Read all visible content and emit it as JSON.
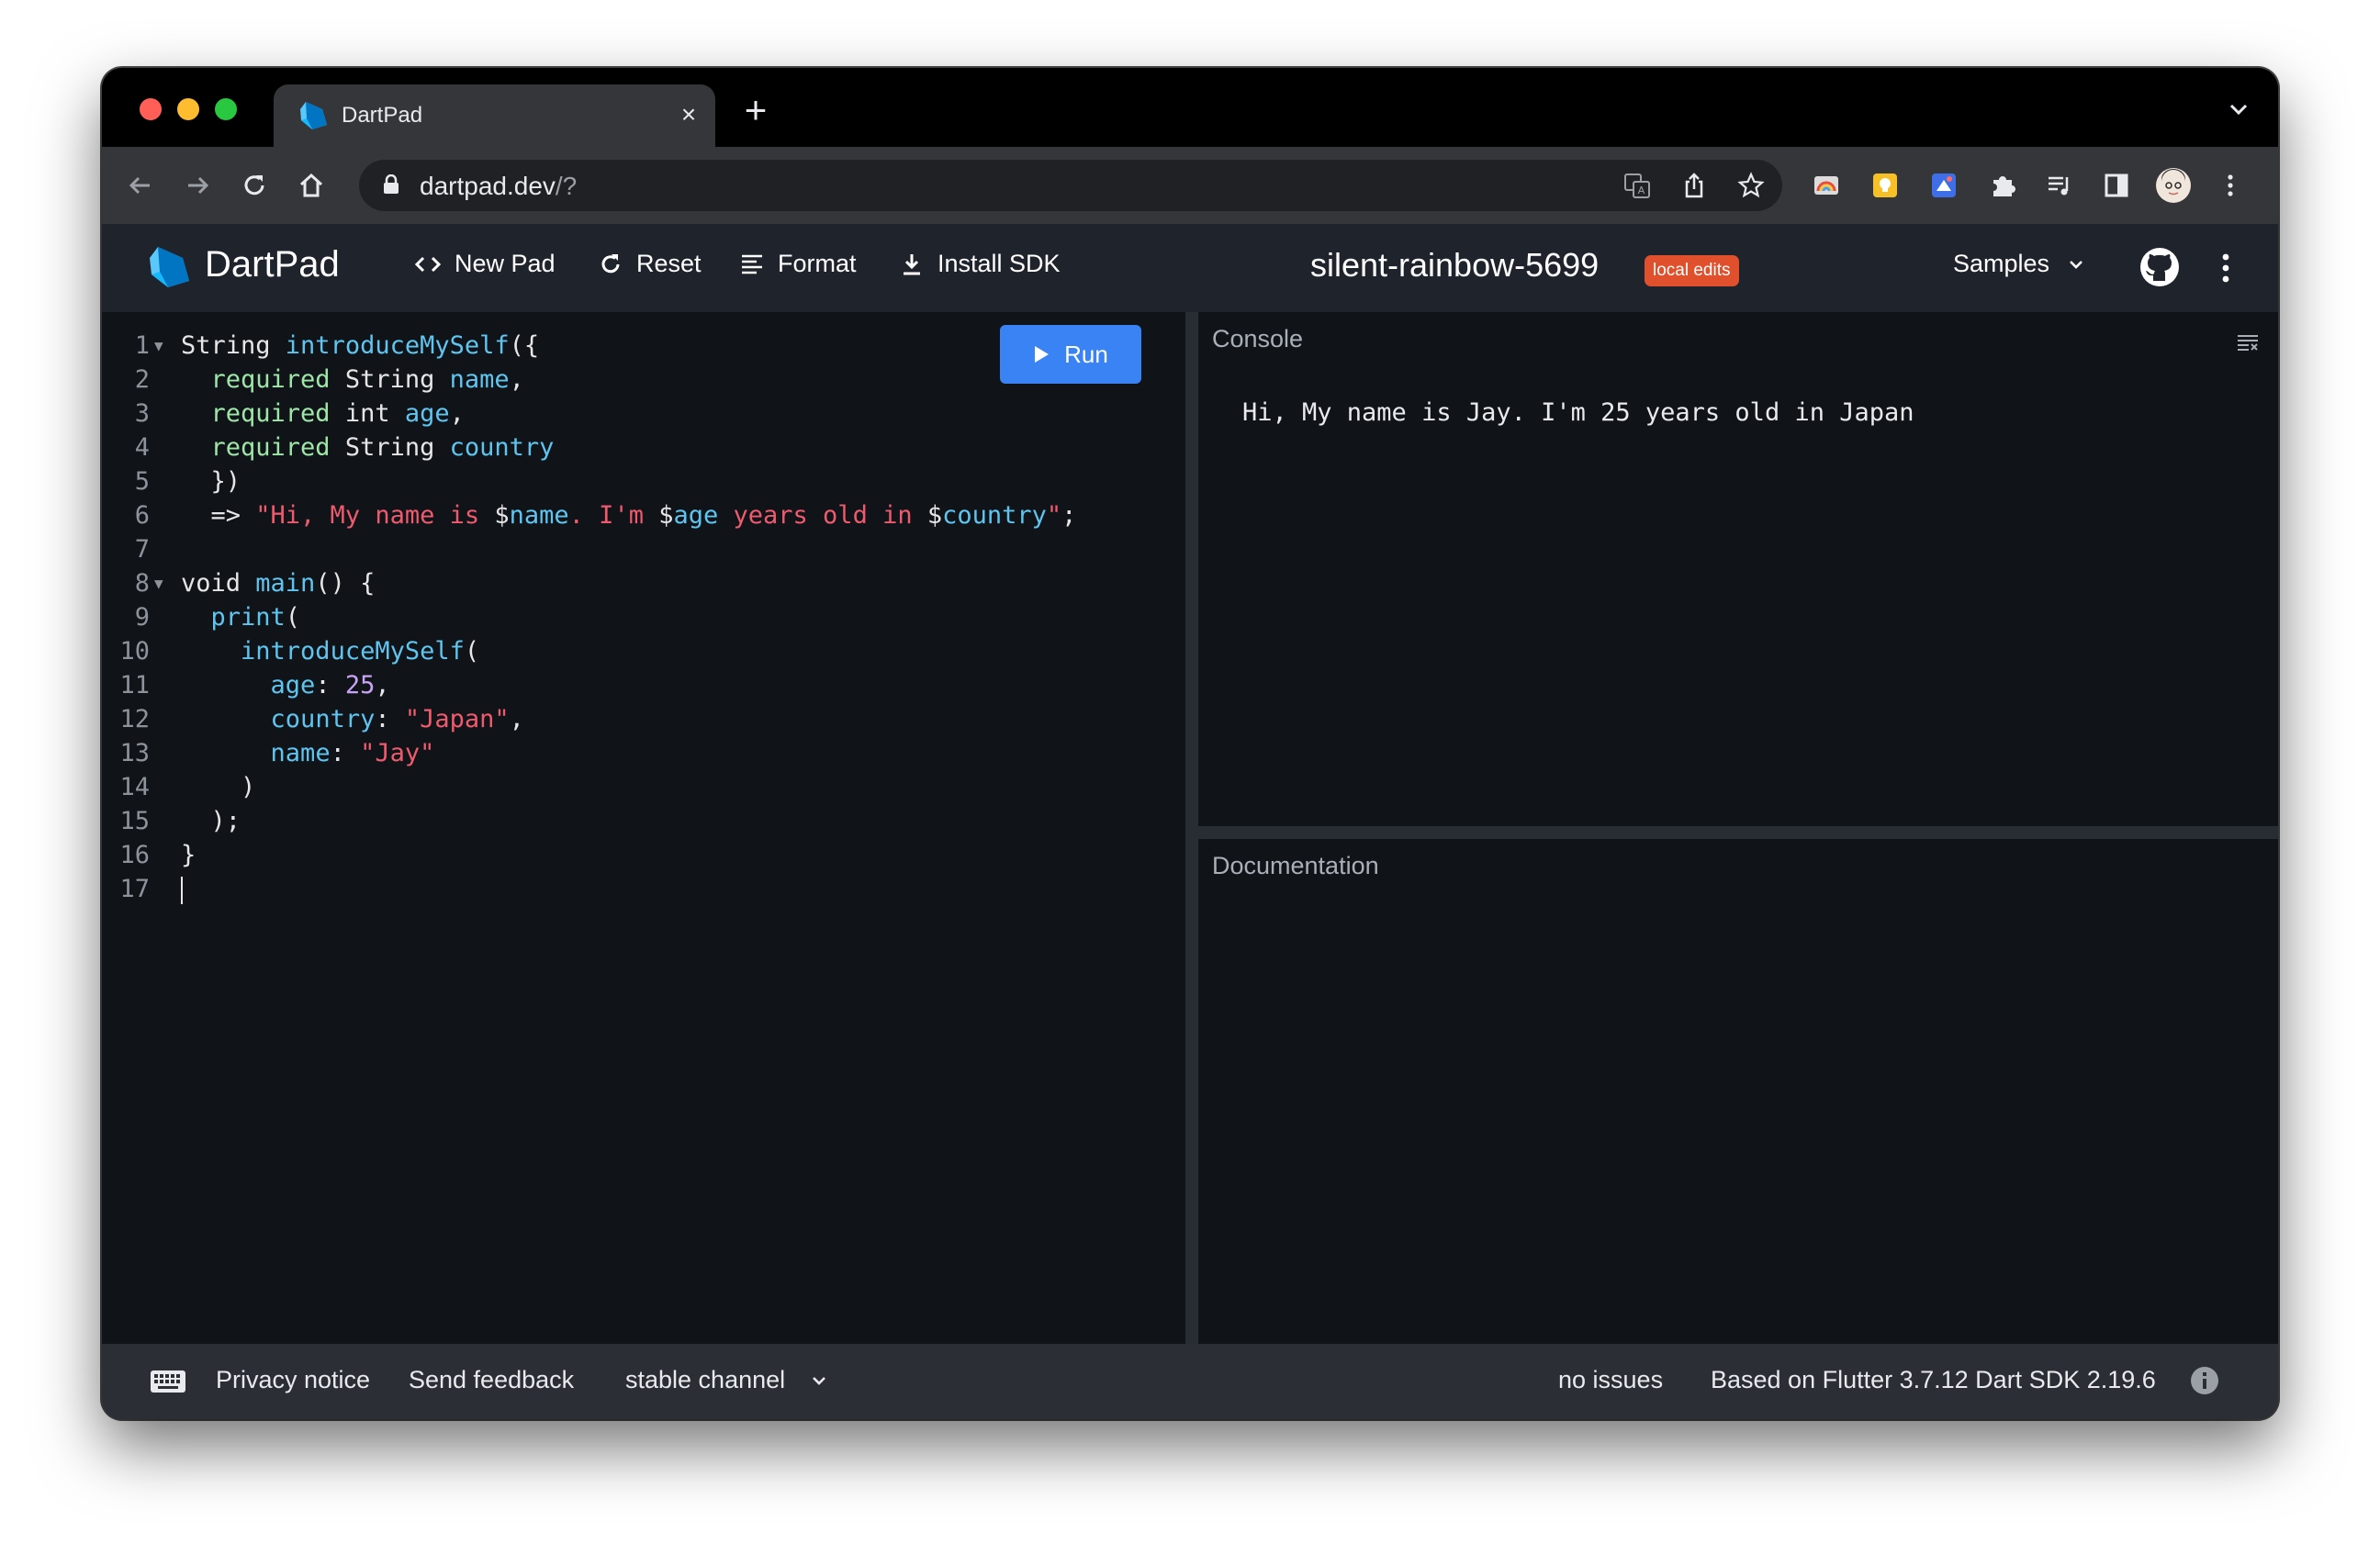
{
  "browser": {
    "tab_title": "DartPad",
    "new_tab_symbol": "+",
    "close_symbol": "×",
    "url_host": "dartpad.dev",
    "url_path": "/?"
  },
  "header": {
    "app_title": "DartPad",
    "new_pad": "New Pad",
    "reset": "Reset",
    "format": "Format",
    "install_sdk": "Install SDK",
    "pad_name": "silent-rainbow-5699",
    "badge": "local edits",
    "samples": "Samples"
  },
  "editor": {
    "run_label": "Run",
    "lines": [
      {
        "n": "1",
        "fold": true,
        "tokens": [
          {
            "t": "String ",
            "c": ""
          },
          {
            "t": "introduceMySelf",
            "c": "fn"
          },
          {
            "t": "({",
            "c": ""
          }
        ]
      },
      {
        "n": "2",
        "fold": false,
        "tokens": [
          {
            "t": "  ",
            "c": ""
          },
          {
            "t": "required",
            "c": "kw"
          },
          {
            "t": " String ",
            "c": ""
          },
          {
            "t": "name",
            "c": "fn"
          },
          {
            "t": ",",
            "c": ""
          }
        ]
      },
      {
        "n": "3",
        "fold": false,
        "tokens": [
          {
            "t": "  ",
            "c": ""
          },
          {
            "t": "required",
            "c": "kw"
          },
          {
            "t": " int ",
            "c": ""
          },
          {
            "t": "age",
            "c": "fn"
          },
          {
            "t": ",",
            "c": ""
          }
        ]
      },
      {
        "n": "4",
        "fold": false,
        "tokens": [
          {
            "t": "  ",
            "c": ""
          },
          {
            "t": "required",
            "c": "kw"
          },
          {
            "t": " String ",
            "c": ""
          },
          {
            "t": "country",
            "c": "fn"
          }
        ]
      },
      {
        "n": "5",
        "fold": false,
        "tokens": [
          {
            "t": "  })",
            "c": ""
          }
        ]
      },
      {
        "n": "6",
        "fold": false,
        "tokens": [
          {
            "t": "  => ",
            "c": ""
          },
          {
            "t": "\"Hi, My name is ",
            "c": "str"
          },
          {
            "t": "$",
            "c": ""
          },
          {
            "t": "name",
            "c": "fn"
          },
          {
            "t": ". I'm ",
            "c": "str"
          },
          {
            "t": "$",
            "c": ""
          },
          {
            "t": "age",
            "c": "fn"
          },
          {
            "t": " years old in ",
            "c": "str"
          },
          {
            "t": "$",
            "c": ""
          },
          {
            "t": "country",
            "c": "fn"
          },
          {
            "t": "\"",
            "c": "str"
          },
          {
            "t": ";",
            "c": ""
          }
        ]
      },
      {
        "n": "7",
        "fold": false,
        "tokens": []
      },
      {
        "n": "8",
        "fold": true,
        "tokens": [
          {
            "t": "void ",
            "c": ""
          },
          {
            "t": "main",
            "c": "fn"
          },
          {
            "t": "() {",
            "c": ""
          }
        ]
      },
      {
        "n": "9",
        "fold": false,
        "tokens": [
          {
            "t": "  ",
            "c": ""
          },
          {
            "t": "print",
            "c": "fn"
          },
          {
            "t": "(",
            "c": ""
          }
        ]
      },
      {
        "n": "10",
        "fold": false,
        "tokens": [
          {
            "t": "    ",
            "c": ""
          },
          {
            "t": "introduceMySelf",
            "c": "fn"
          },
          {
            "t": "(",
            "c": ""
          }
        ]
      },
      {
        "n": "11",
        "fold": false,
        "tokens": [
          {
            "t": "      ",
            "c": ""
          },
          {
            "t": "age",
            "c": "fn"
          },
          {
            "t": ": ",
            "c": ""
          },
          {
            "t": "25",
            "c": "num"
          },
          {
            "t": ",",
            "c": ""
          }
        ]
      },
      {
        "n": "12",
        "fold": false,
        "tokens": [
          {
            "t": "      ",
            "c": ""
          },
          {
            "t": "country",
            "c": "fn"
          },
          {
            "t": ": ",
            "c": ""
          },
          {
            "t": "\"Japan\"",
            "c": "str"
          },
          {
            "t": ",",
            "c": ""
          }
        ]
      },
      {
        "n": "13",
        "fold": false,
        "tokens": [
          {
            "t": "      ",
            "c": ""
          },
          {
            "t": "name",
            "c": "fn"
          },
          {
            "t": ": ",
            "c": ""
          },
          {
            "t": "\"Jay\"",
            "c": "str"
          }
        ]
      },
      {
        "n": "14",
        "fold": false,
        "tokens": [
          {
            "t": "    )",
            "c": ""
          }
        ]
      },
      {
        "n": "15",
        "fold": false,
        "tokens": [
          {
            "t": "  );",
            "c": ""
          }
        ]
      },
      {
        "n": "16",
        "fold": false,
        "tokens": [
          {
            "t": "}",
            "c": ""
          }
        ]
      },
      {
        "n": "17",
        "fold": false,
        "tokens": [],
        "cursor": true
      }
    ]
  },
  "console": {
    "title": "Console",
    "output": "Hi, My name is Jay. I'm 25 years old in Japan"
  },
  "documentation": {
    "title": "Documentation"
  },
  "footer": {
    "privacy": "Privacy notice",
    "feedback": "Send feedback",
    "channel": "stable channel",
    "issues": "no issues",
    "version": "Based on Flutter 3.7.12 Dart SDK 2.19.6"
  },
  "colors": {
    "accent": "#3983f5",
    "badge": "#e0502c",
    "keyword": "#9ee6a8",
    "identifier": "#5fc5f0",
    "string": "#f05a6e",
    "number": "#c9a3f5"
  }
}
